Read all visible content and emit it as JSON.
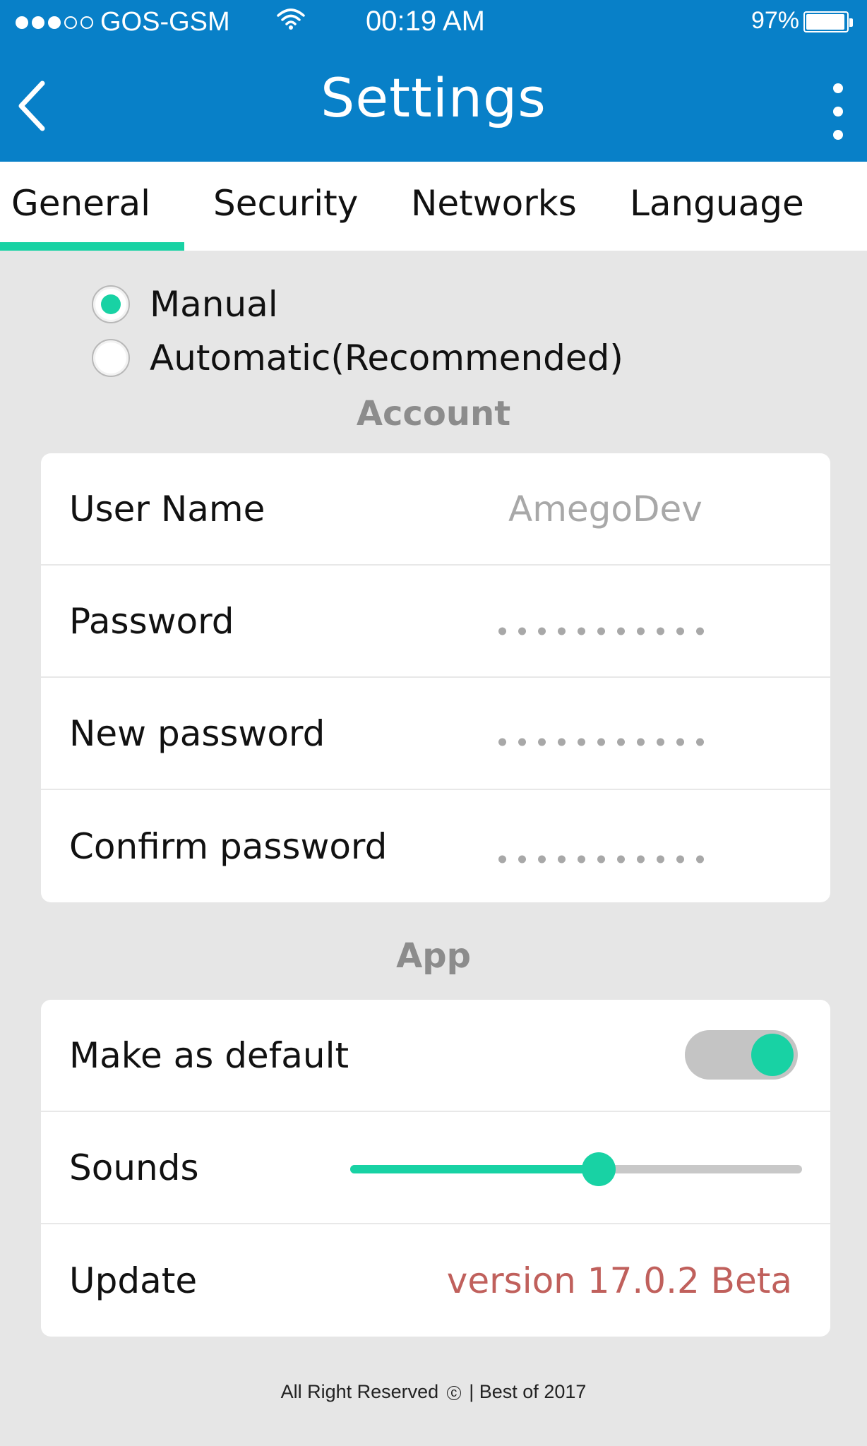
{
  "status_bar": {
    "carrier": "GOS-GSM",
    "signal_bars_filled": 3,
    "signal_bars_total": 5,
    "time": "00:19 AM",
    "battery_percent": "97%",
    "battery_level": 0.97
  },
  "app_bar": {
    "title": "Settings",
    "back_icon": "chevron-left-icon",
    "menu_icon": "more-vertical-icon"
  },
  "tabs": [
    {
      "label": "General",
      "selected": true
    },
    {
      "label": "Security",
      "selected": false
    },
    {
      "label": "Networks",
      "selected": false
    },
    {
      "label": "Language",
      "selected": false
    }
  ],
  "mode_options": [
    {
      "label": "Manual",
      "checked": true
    },
    {
      "label": "Automatic(Recommended)",
      "checked": false
    }
  ],
  "account": {
    "title": "Account",
    "user_name_label": "User Name",
    "user_name_value": "AmegoDev",
    "password_label": "Password",
    "new_password_label": "New password",
    "confirm_password_label": "Confirm password",
    "masked_length": 11
  },
  "app": {
    "title": "App",
    "default_label": "Make as default",
    "default_on": true,
    "sounds_label": "Sounds",
    "sounds_level": 0.55,
    "update_label": "Update",
    "update_value": "version 17.0.2 Beta"
  },
  "footer": {
    "left": "All Right Reserved",
    "separator": "|",
    "right": "Best of 2017"
  },
  "colors": {
    "primary": "#0880c8",
    "accent": "#18d2a4",
    "version_text": "#c0605c",
    "section_title": "#8c8c8c",
    "background": "#e6e6e6"
  }
}
